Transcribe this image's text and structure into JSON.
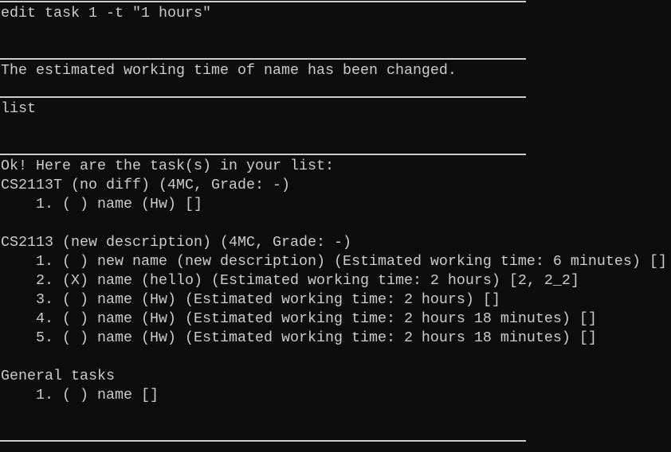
{
  "colors": {
    "background": "#0c0c0c",
    "text": "#cccccc"
  },
  "terminal": {
    "command_1": "edit task 1 -t \"1 hours\"",
    "response_1": "The estimated working time of name has been changed.",
    "command_2": "list",
    "response_2": {
      "header": "Ok! Here are the task(s) in your list:",
      "modules": [
        {
          "title": "CS2113T (no diff) (4MC, Grade: -)",
          "tasks": [
            "    1. ( ) name (Hw) []"
          ]
        },
        {
          "title": "CS2113 (new description) (4MC, Grade: -)",
          "tasks": [
            "    1. ( ) new name (new description) (Estimated working time: 6 minutes) []",
            "    2. (X) name (hello) (Estimated working time: 2 hours) [2, 2_2]",
            "    3. ( ) name (Hw) (Estimated working time: 2 hours) []",
            "    4. ( ) name (Hw) (Estimated working time: 2 hours 18 minutes) []",
            "    5. ( ) name (Hw) (Estimated working time: 2 hours 18 minutes) []"
          ]
        }
      ],
      "general": {
        "title": "General tasks",
        "tasks": [
          "    1. ( ) name []"
        ]
      }
    }
  }
}
